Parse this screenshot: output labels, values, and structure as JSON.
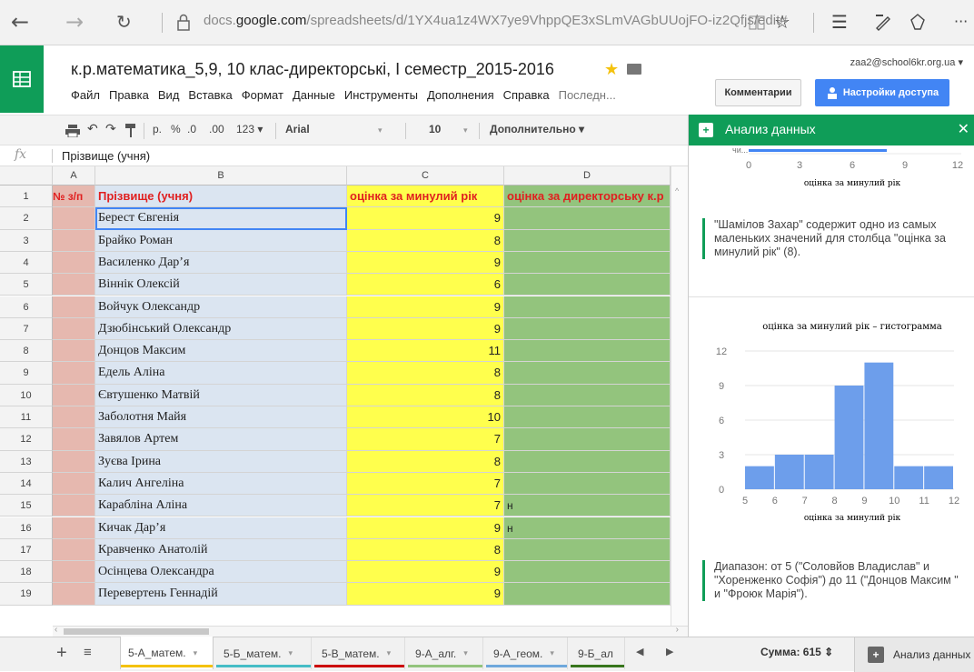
{
  "browser": {
    "url_prefix": "docs.",
    "url_domain": "google.com",
    "url_rest": "/spreadsheets/d/1YX4ua1z4WX7ye9VhppQE3xSLmVAGbUUojFO-iz2Qfjs/edit#",
    "back_icon": "arrow-left-icon",
    "forward_icon": "arrow-right-icon",
    "reload_icon": "reload-icon",
    "lock_icon": "lock-icon"
  },
  "app": {
    "title": "к.р.математика_5,9, 10 клас-директорські, I  семестр_2015-2016",
    "user_email": "zaa2@school6kr.org.ua ▾",
    "comments_label": "Комментарии",
    "share_label": "Настройки доступа",
    "menu": [
      "Файл",
      "Правка",
      "Вид",
      "Вставка",
      "Формат",
      "Данные",
      "Инструменты",
      "Дополнения",
      "Справка",
      "Последн..."
    ]
  },
  "toolbar": {
    "currency": "р.",
    "percent": "%",
    "dec_less": ".0",
    "dec_more": ".00",
    "format_more": "123 ▾",
    "font": "Arial",
    "font_size": "10",
    "more": "Дополнительно ▾"
  },
  "formula": {
    "fx": "fx",
    "content": "Прізвище (учня)"
  },
  "columns": [
    "A",
    "B",
    "C",
    "D"
  ],
  "rows": [
    {
      "num": "1",
      "a": "№ з/п",
      "b": "Прізвище (учня)",
      "c": "оцінка  за  минулий  рік",
      "d": "оцінка за  директорську к.р"
    },
    {
      "num": "2",
      "a": "",
      "b": "Берест Євгенія",
      "c": "9",
      "d": ""
    },
    {
      "num": "3",
      "a": "",
      "b": "Брайко Роман",
      "c": "8",
      "d": ""
    },
    {
      "num": "4",
      "a": "",
      "b": "Василенко Дар’я",
      "c": "9",
      "d": ""
    },
    {
      "num": "5",
      "a": "",
      "b": "Віннік Олексій",
      "c": "6",
      "d": ""
    },
    {
      "num": "6",
      "a": "",
      "b": "Войчук Олександр",
      "c": "9",
      "d": ""
    },
    {
      "num": "7",
      "a": "",
      "b": "Дзюбінський Олександр",
      "c": "9",
      "d": ""
    },
    {
      "num": "8",
      "a": "",
      "b": "Донцов Максим",
      "c": "11",
      "d": ""
    },
    {
      "num": "9",
      "a": "",
      "b": "Едель Аліна",
      "c": "8",
      "d": ""
    },
    {
      "num": "10",
      "a": "",
      "b": "Євтушенко Матвій",
      "c": "8",
      "d": ""
    },
    {
      "num": "11",
      "a": "",
      "b": "Заболотня Майя",
      "c": "10",
      "d": ""
    },
    {
      "num": "12",
      "a": "",
      "b": "Завялов Артем",
      "c": "7",
      "d": ""
    },
    {
      "num": "13",
      "a": "",
      "b": "Зуєва Ірина",
      "c": "8",
      "d": ""
    },
    {
      "num": "14",
      "a": "",
      "b": "Калич Ангеліна",
      "c": "7",
      "d": ""
    },
    {
      "num": "15",
      "a": "",
      "b": "Карабліна Аліна",
      "c": "7",
      "d": "н"
    },
    {
      "num": "16",
      "a": "",
      "b": "Кичак Дар’я",
      "c": "9",
      "d": "н"
    },
    {
      "num": "17",
      "a": "",
      "b": "Кравченко Анатолій",
      "c": "8",
      "d": ""
    },
    {
      "num": "18",
      "a": "",
      "b": "Осінцева Олександра",
      "c": "9",
      "d": ""
    },
    {
      "num": "19",
      "a": "",
      "b": "Перевертень Геннадій",
      "c": "9",
      "d": ""
    }
  ],
  "sheet_tabs": [
    {
      "label": "5-А_матем.",
      "color": "#f4c20d"
    },
    {
      "label": "5-Б_матем.",
      "color": "#46bdc6"
    },
    {
      "label": "5-В_матем.",
      "color": "#cc0000"
    },
    {
      "label": "9-А_алг.",
      "color": "#93c47d"
    },
    {
      "label": "9-А_геом.",
      "color": "#6fa8dc"
    },
    {
      "label": "9-Б_ал",
      "color": "#38761d"
    }
  ],
  "status": {
    "sum": "Сумма: 615 ⇕",
    "explore_label": "Анализ данных"
  },
  "panel": {
    "title": "Анализ данных",
    "close_icon": "close-icon",
    "top_chart_ticks": [
      "0",
      "3",
      "6",
      "9",
      "12"
    ],
    "top_chart_xlabel": "оцінка за минулий рік",
    "top_chart_truncated_label": "чи...",
    "insight1": "\"Шамілов Захар\" содержит одно из самых маленьких значений для столбца \"оцінка за  минулий  рік\" (8).",
    "insight2": "Диапазон: от 5 (\"Соловйов Владислав\" и \"Хоренженко Софія\") до 11 (\"Донцов Максим \" и \"Фроюк Марія\")."
  },
  "chart_data": {
    "type": "bar",
    "title": "оцінка  за  минулий  рік – гистограмма",
    "xlabel": "оцінка за минулий рік",
    "ylabel": "",
    "x_ticks": [
      "5",
      "6",
      "7",
      "8",
      "9",
      "10",
      "11",
      "12"
    ],
    "y_ticks": [
      "0",
      "3",
      "6",
      "9",
      "12"
    ],
    "ylim": [
      0,
      12
    ],
    "xlim": [
      5,
      12
    ],
    "bins": [
      {
        "from": 5,
        "to": 6,
        "count": 2
      },
      {
        "from": 6,
        "to": 7,
        "count": 3
      },
      {
        "from": 7,
        "to": 8,
        "count": 3
      },
      {
        "from": 8,
        "to": 9,
        "count": 9
      },
      {
        "from": 9,
        "to": 10,
        "count": 11
      },
      {
        "from": 10,
        "to": 11,
        "count": 2
      },
      {
        "from": 11,
        "to": 12,
        "count": 2
      }
    ],
    "color": "#6d9eeb"
  }
}
